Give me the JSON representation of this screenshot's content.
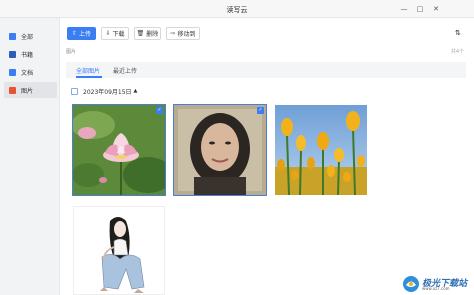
{
  "window": {
    "title": "读写云",
    "min_glyph": "—",
    "max_glyph": "□",
    "close_glyph": "✕"
  },
  "sidebar": {
    "items": [
      {
        "label": "全部",
        "icon": "all-icon",
        "color": "#3b7df2"
      },
      {
        "label": "书籍",
        "icon": "book-icon",
        "color": "#2e5fb8"
      },
      {
        "label": "文档",
        "icon": "document-icon",
        "color": "#3b7df2"
      },
      {
        "label": "图片",
        "icon": "image-icon",
        "color": "#e8542f",
        "active": true
      }
    ]
  },
  "toolbar": {
    "upload": "上传",
    "download": "下载",
    "delete": "删除",
    "move": "移动到",
    "upload_glyph": "⇧",
    "download_glyph": "⇩",
    "delete_glyph": "🗑",
    "move_glyph": "⇨",
    "sort_glyph": "⇅"
  },
  "breadcrumb": "图片",
  "count": "共4个",
  "tabs": [
    {
      "label": "全部图片",
      "active": true
    },
    {
      "label": "最近上传",
      "active": false
    }
  ],
  "date_group": {
    "label": "2023年09月15日",
    "arrow": "▲"
  },
  "photos": [
    {
      "subject": "lotus",
      "selected": true
    },
    {
      "subject": "portrait",
      "selected": true
    },
    {
      "subject": "tulips",
      "selected": false
    },
    {
      "subject": "sketch",
      "selected": false
    }
  ],
  "check_glyph": "✓",
  "watermark": {
    "title": "极光下载站",
    "url": "www.xz7.com"
  },
  "colors": {
    "accent": "#3b7df2"
  }
}
